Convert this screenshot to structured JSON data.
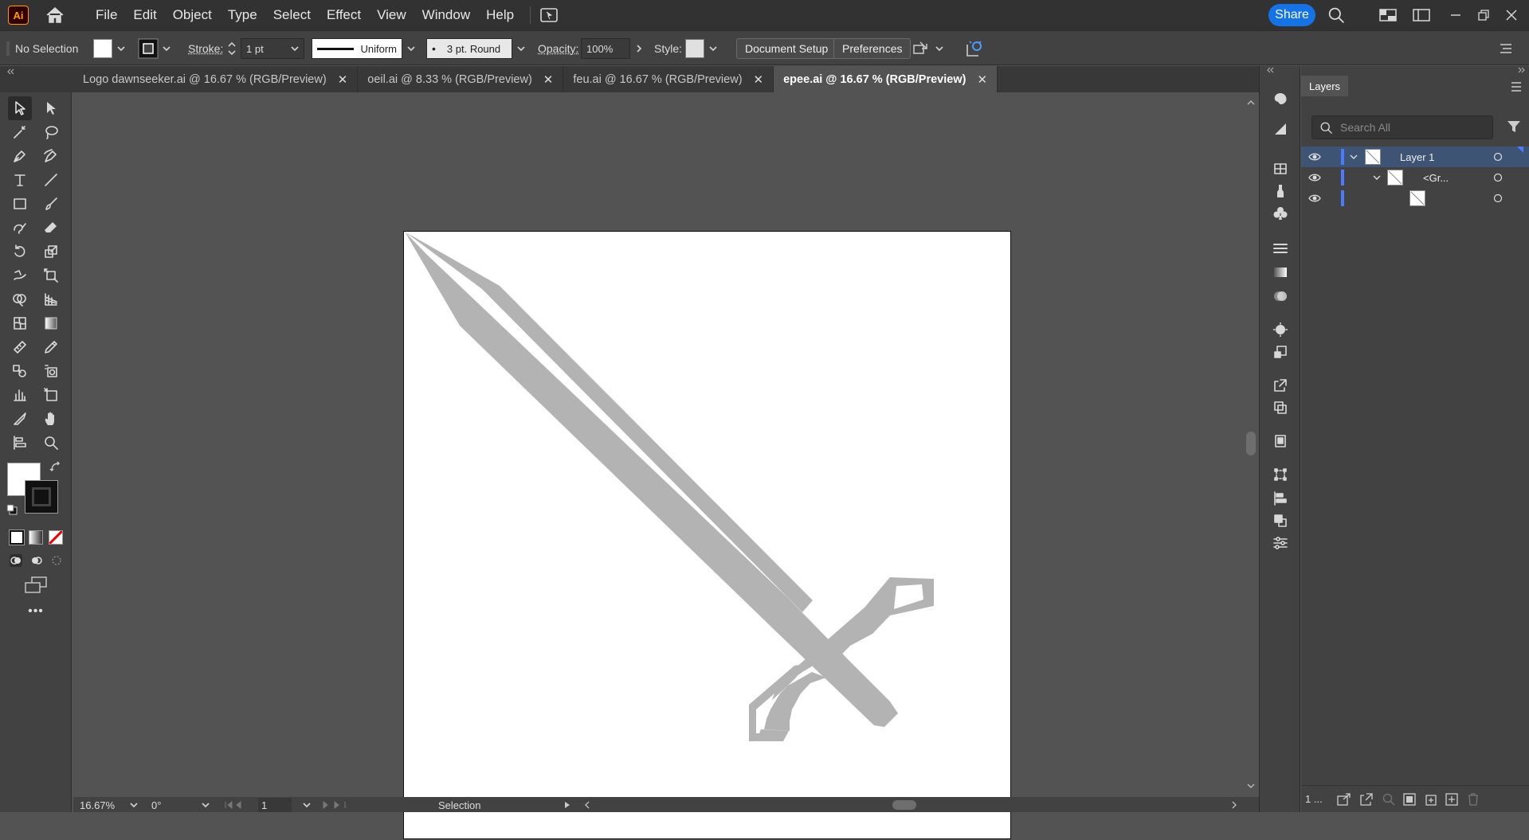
{
  "menubar": {
    "logo": "Ai",
    "menus": [
      "File",
      "Edit",
      "Object",
      "Type",
      "Select",
      "Effect",
      "View",
      "Window",
      "Help"
    ],
    "share_label": "Share"
  },
  "controlbar": {
    "selection": "No Selection",
    "stroke_label": "Stroke:",
    "stroke_weight": "1 pt",
    "profile": "Uniform",
    "brush": "3 pt. Round",
    "opacity_label": "Opacity:",
    "opacity": "100%",
    "style_label": "Style:",
    "doc_setup": "Document Setup",
    "preferences": "Preferences"
  },
  "tabs": [
    {
      "label": "Logo dawnseeker.ai @ 16.67 % (RGB/Preview)",
      "active": false
    },
    {
      "label": "oeil.ai @ 8.33 % (RGB/Preview)",
      "active": false
    },
    {
      "label": "feu.ai @ 16.67 % (RGB/Preview)",
      "active": false
    },
    {
      "label": "epee.ai @ 16.67 % (RGB/Preview)",
      "active": true
    }
  ],
  "tab_close": "✕",
  "statusbar": {
    "zoom": "16.67%",
    "rotation": "0°",
    "artboard": "1",
    "tool": "Selection"
  },
  "layers": {
    "title": "Layers",
    "search_placeholder": "Search All",
    "rows": [
      {
        "name": "Layer 1"
      },
      {
        "name": "<Gr..."
      },
      {
        "name": ""
      }
    ],
    "footer_count": "1 ..."
  },
  "colors": {
    "accent": "#1473e6",
    "sword": "#b3b3b3",
    "layer_highlight": "#3e5475",
    "layer_color": "#4b7bff"
  },
  "more_tools": "•••"
}
